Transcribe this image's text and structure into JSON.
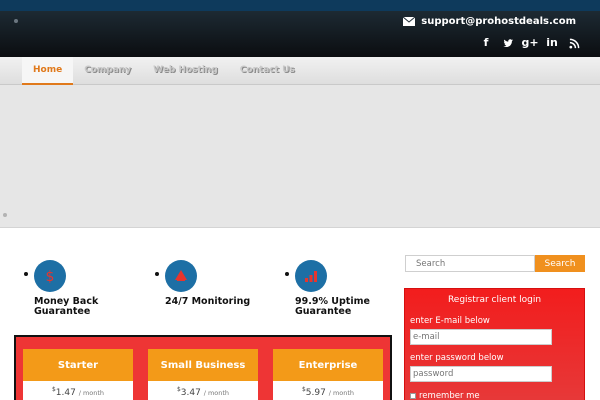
{
  "header": {
    "support_email": "support@prohostdeals.com",
    "social_icons": [
      "facebook-icon",
      "twitter-icon",
      "google-plus-icon",
      "linkedin-icon",
      "rss-icon"
    ],
    "social_labels": {
      "facebook": "f",
      "google_plus": "g+",
      "linkedin": "in"
    }
  },
  "nav": {
    "items": [
      {
        "label": "Home",
        "active": true
      },
      {
        "label": "Company",
        "active": false
      },
      {
        "label": "Web Hosting",
        "active": false
      },
      {
        "label": "Contact Us",
        "active": false
      }
    ]
  },
  "features": [
    {
      "icon": "dollar-icon",
      "label": "Money Back Guarantee"
    },
    {
      "icon": "monitoring-icon",
      "label": "24/7 Monitoring"
    },
    {
      "icon": "uptime-chart-icon",
      "label": "99.9% Uptime Guarantee"
    }
  ],
  "plans": [
    {
      "name": "Starter",
      "currency": "$",
      "price": "1.47",
      "period": "/ month"
    },
    {
      "name": "Small Business",
      "currency": "$",
      "price": "3.47",
      "period": "/ month"
    },
    {
      "name": "Enterprise",
      "currency": "$",
      "price": "5.97",
      "period": "/ month"
    }
  ],
  "search": {
    "placeholder": "Search",
    "button_label": "Search"
  },
  "login": {
    "title": "Registrar client login",
    "email_label": "enter E-mail below",
    "email_placeholder": "e-mail",
    "password_label": "enter password below",
    "password_placeholder": "password",
    "remember_label": "remember me"
  },
  "colors": {
    "accent": "#f0901e",
    "header_bg": "#0b0d10",
    "feature_icon": "#1d6fa5",
    "plans_bg": "#ee3535",
    "login_bg": "#f21d1d"
  }
}
